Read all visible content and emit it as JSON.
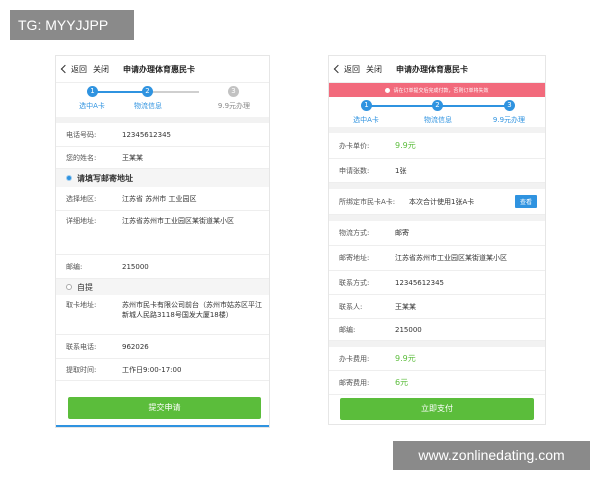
{
  "watermarks": {
    "top_left": "TG: MYYJJPP",
    "bottom_right": "www.zonlinedating.com"
  },
  "colors": {
    "accent_blue": "#2f93e0",
    "accent_green": "#5bbd3b",
    "warning_red": "#f26a7c"
  },
  "left": {
    "nav": {
      "back": "返回",
      "close": "关闭",
      "title": "申请办理体育惠民卡"
    },
    "steps": [
      {
        "num": "1",
        "label": "选中A卡",
        "active": true
      },
      {
        "num": "2",
        "label": "物流信息",
        "active": true
      },
      {
        "num": "3",
        "label": "9.9元办理",
        "active": false
      }
    ],
    "phone": {
      "label": "电话号码:",
      "value": "12345612345"
    },
    "name": {
      "label": "您的姓名:",
      "value": "王某某"
    },
    "mail_option": "请填写邮寄地址",
    "region": {
      "label": "选择地区:",
      "value": "江苏省 苏州市 工业园区"
    },
    "address": {
      "label": "详细地址:",
      "value": "江苏省苏州市工业园区某街道某小区"
    },
    "postcode": {
      "label": "邮编:",
      "value": "215000"
    },
    "pickup_option": "自提",
    "pickup_address": {
      "label": "取卡地址:",
      "value": "苏州市民卡有限公司前台（苏州市姑苏区平江新城人民路3118号国发大厦18楼）"
    },
    "contact_phone": {
      "label": "联系电话:",
      "value": "962026"
    },
    "pickup_time": {
      "label": "提取时间:",
      "value": "工作日9:00-17:00"
    },
    "submit": "提交申请"
  },
  "right": {
    "nav": {
      "back": "返回",
      "close": "关闭",
      "title": "申请办理体育惠民卡"
    },
    "warning": "请在订单提交后完成付款，否则订单将失效",
    "steps": [
      {
        "num": "1",
        "label": "选中A卡"
      },
      {
        "num": "2",
        "label": "物流信息"
      },
      {
        "num": "3",
        "label": "9.9元办理"
      }
    ],
    "unit_price": {
      "label": "办卡单价:",
      "value": "9.9元"
    },
    "count": {
      "label": "申请张数:",
      "value": "1张"
    },
    "bound": {
      "label": "所绑定市民卡A卡:",
      "value": "本次合计使用1张A卡",
      "button": "查看"
    },
    "logistics": {
      "label": "物流方式:",
      "value": "邮寄"
    },
    "mail_address": {
      "label": "邮寄地址:",
      "value": "江苏省苏州市工业园区某街道某小区"
    },
    "contact": {
      "label": "联系方式:",
      "value": "12345612345"
    },
    "contact_person": {
      "label": "联系人:",
      "value": "王某某"
    },
    "postcode": {
      "label": "邮编:",
      "value": "215000"
    },
    "card_fee": {
      "label": "办卡费用:",
      "value": "9.9元"
    },
    "mail_fee": {
      "label": "邮寄费用:",
      "value": "6元"
    },
    "pay": "立即支付"
  }
}
